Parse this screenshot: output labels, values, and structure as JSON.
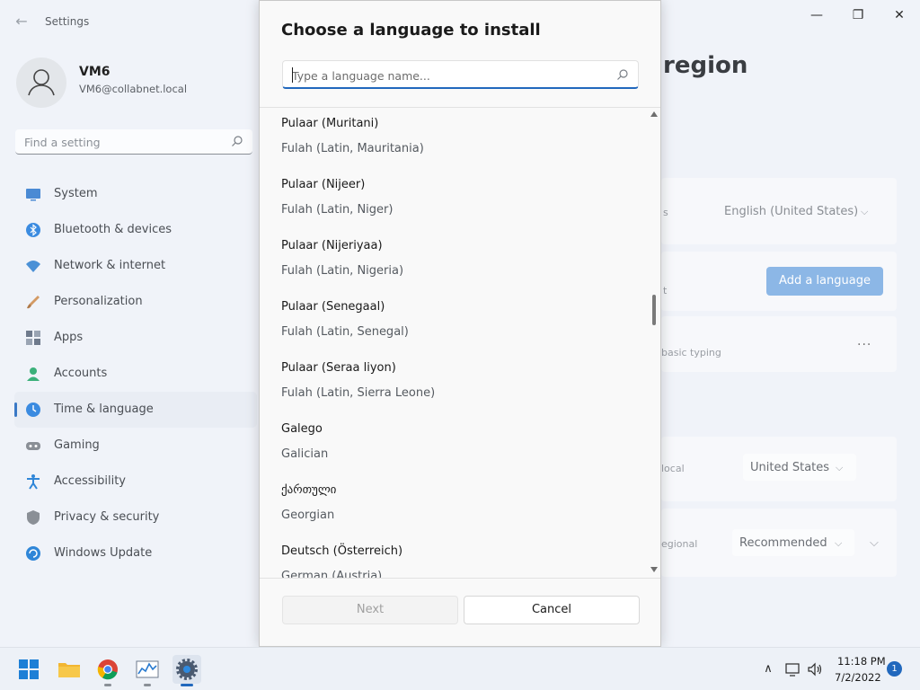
{
  "settings_window": {
    "app_title": "Settings",
    "back_glyph": "←",
    "controls": {
      "minimize": "—",
      "maximize": "❐",
      "close": "✕"
    },
    "profile": {
      "name": "VM6",
      "email": "VM6@collabnet.local"
    },
    "search": {
      "placeholder": "Find a setting",
      "icon": "search-icon"
    },
    "nav": [
      {
        "label": "System",
        "icon": "system-icon",
        "color": "#4a8ad4"
      },
      {
        "label": "Bluetooth & devices",
        "icon": "bluetooth-icon",
        "color": "#3b8be0"
      },
      {
        "label": "Network & internet",
        "icon": "network-icon",
        "color": "#4a90d6"
      },
      {
        "label": "Personalization",
        "icon": "brush-icon",
        "color": "#d39a64"
      },
      {
        "label": "Apps",
        "icon": "apps-icon",
        "color": "#6f7a8c"
      },
      {
        "label": "Accounts",
        "icon": "accounts-icon",
        "color": "#3bb07a"
      },
      {
        "label": "Time & language",
        "icon": "time-language-icon",
        "color": "#3b8be0",
        "active": true
      },
      {
        "label": "Gaming",
        "icon": "gaming-icon",
        "color": "#8a8f96"
      },
      {
        "label": "Accessibility",
        "icon": "accessibility-icon",
        "color": "#2f86d8"
      },
      {
        "label": "Privacy & security",
        "icon": "shield-icon",
        "color": "#8a8f96"
      },
      {
        "label": "Windows Update",
        "icon": "windows-update-icon",
        "color": "#2f86d8"
      }
    ],
    "content": {
      "header_fragment": "region",
      "row1_label_fragment": "s",
      "row1_value": "English (United States)",
      "row2_label_fragment": "t",
      "add_language_label": "Add a language",
      "row3_label_fragment": "basic typing",
      "row3_more": "···",
      "row4_label_fragment": "local",
      "row4_value": "United States",
      "row5_label_fragment": "egional",
      "row5_value": "Recommended"
    }
  },
  "dialog": {
    "title": "Choose a language to install",
    "search": {
      "placeholder": "Type a language name...",
      "icon": "search-icon"
    },
    "languages": [
      {
        "native": "Pulaar (Muritani)",
        "english": "Fulah (Latin, Mauritania)"
      },
      {
        "native": "Pulaar (Nijeer)",
        "english": "Fulah (Latin, Niger)"
      },
      {
        "native": "Pulaar (Nijeriyaa)",
        "english": "Fulah (Latin, Nigeria)"
      },
      {
        "native": "Pulaar (Senegaal)",
        "english": "Fulah (Latin, Senegal)"
      },
      {
        "native": "Pulaar (Seraa liyon)",
        "english": "Fulah (Latin, Sierra Leone)"
      },
      {
        "native": "Galego",
        "english": "Galician"
      },
      {
        "native": "ქართული",
        "english": "Georgian"
      },
      {
        "native": "Deutsch (Österreich)",
        "english": "German (Austria)"
      }
    ],
    "buttons": {
      "next": "Next",
      "cancel": "Cancel"
    }
  },
  "taskbar": {
    "apps": [
      {
        "name": "start-button",
        "icon": "windows-logo-icon"
      },
      {
        "name": "file-explorer",
        "icon": "folder-icon"
      },
      {
        "name": "chrome",
        "icon": "chrome-icon"
      },
      {
        "name": "task-manager",
        "icon": "chart-icon"
      },
      {
        "name": "settings",
        "icon": "gear-icon",
        "active": true
      }
    ],
    "tray": {
      "chevron": "∧",
      "time": "11:18 PM",
      "date": "7/2/2022",
      "notification_count": "1"
    }
  },
  "colors": {
    "accent": "#2168bd",
    "window_bg": "#f0f3f9",
    "dialog_bg": "#f9f9f9",
    "add_button_bg": "#8cb7e6"
  }
}
